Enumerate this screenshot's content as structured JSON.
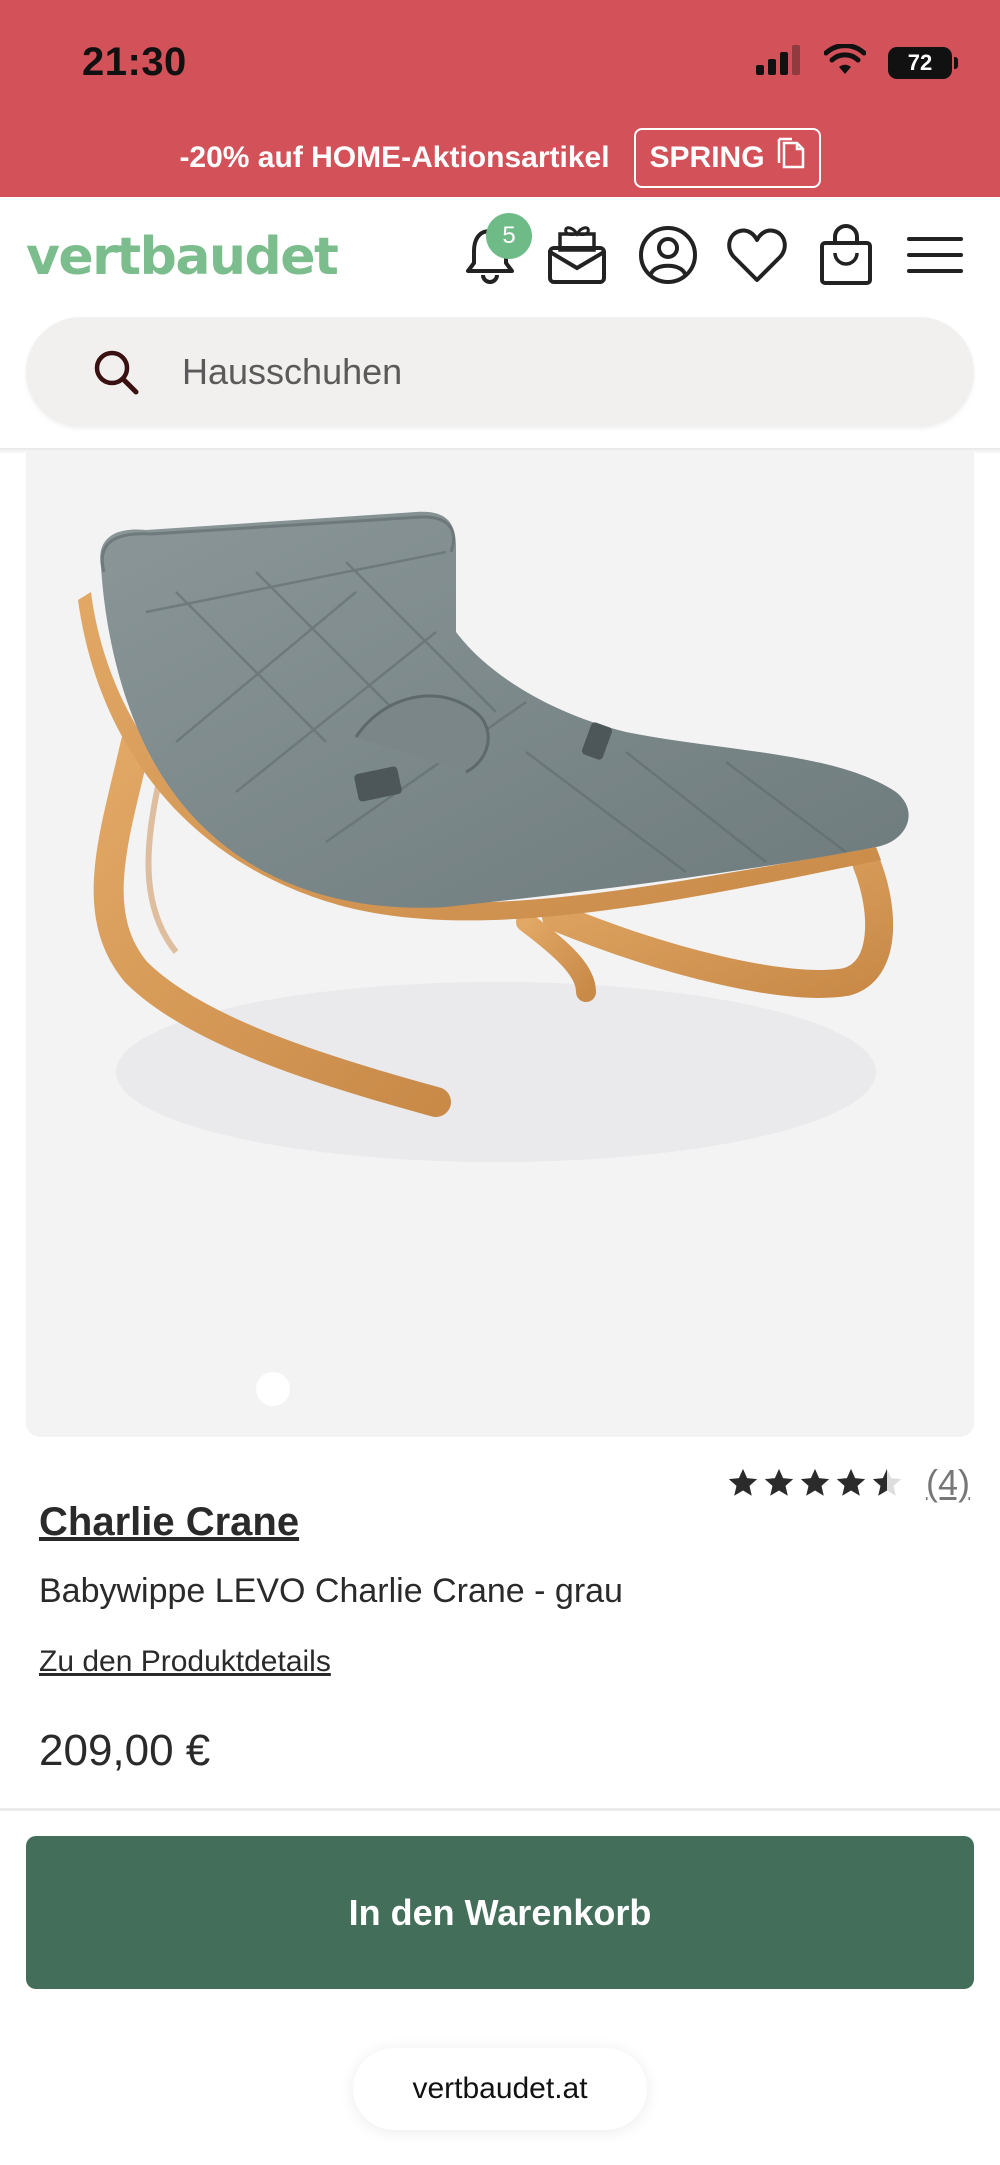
{
  "status_bar": {
    "time": "21:30",
    "battery": "72",
    "icons": [
      "signal-icon",
      "wifi-icon",
      "battery-icon"
    ]
  },
  "promo": {
    "text": "-20% auf HOME-Aktionsartikel",
    "code": "SPRING",
    "background_color": "#d3525a"
  },
  "header": {
    "logo": "vertbaudet",
    "logo_color": "#7bbd8c",
    "notification_count": "5",
    "icons": [
      "bell-icon",
      "gift-mail-icon",
      "account-icon",
      "heart-icon",
      "shopping-bag-icon",
      "menu-icon"
    ]
  },
  "search": {
    "placeholder": "Hausschuhen"
  },
  "gallery": {
    "image": "grey cushioned baby rocker with wooden frame",
    "image_count_indicator": 1
  },
  "product": {
    "rating": 4.5,
    "rating_max": 5,
    "review_count": "(4)",
    "brand": "Charlie Crane",
    "name": "Babywippe LEVO Charlie Crane - grau",
    "details_link": "Zu den Produktdetails",
    "price": "209,00 €"
  },
  "actions": {
    "add_to_cart": "In den Warenkorb",
    "button_color": "#426e5a"
  },
  "browser": {
    "domain": "vertbaudet.at"
  }
}
